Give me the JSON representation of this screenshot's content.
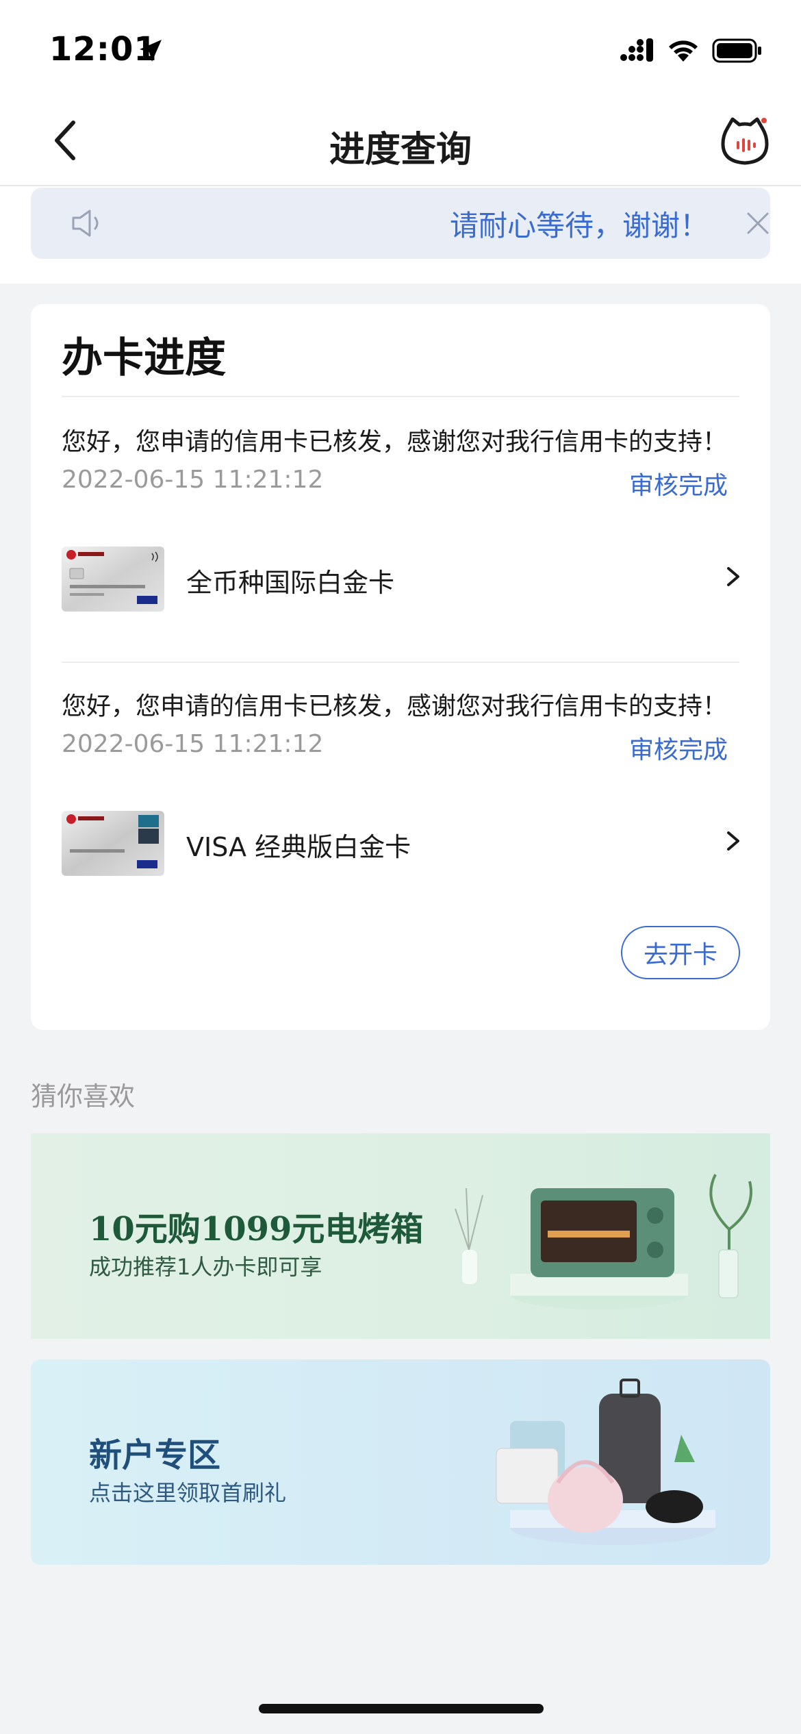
{
  "status_bar": {
    "time": "12:01"
  },
  "nav": {
    "title": "进度查询"
  },
  "notice": {
    "text": "请耐心等待，谢谢！"
  },
  "progress_card": {
    "title": "办卡进度",
    "items": [
      {
        "message": "您好，您申请的信用卡已核发，感谢您对我行信用卡的支持！",
        "time": "2022-06-15 11:21:12",
        "status": "审核完成",
        "card_name": "全币种国际白金卡"
      },
      {
        "message": "您好，您申请的信用卡已核发，感谢您对我行信用卡的支持！",
        "time": "2022-06-15 11:21:12",
        "status": "审核完成",
        "card_name": "VISA 经典版白金卡"
      }
    ],
    "open_button": "去开卡"
  },
  "recommend": {
    "title": "猜你喜欢",
    "banners": [
      {
        "title": "10元购1099元电烤箱",
        "subtitle": "成功推荐1人办卡即可享"
      },
      {
        "title": "新户专区",
        "subtitle": "点击这里领取首刷礼"
      }
    ]
  },
  "colors": {
    "accent": "#3a6bd0",
    "background": "#f2f3f5"
  }
}
